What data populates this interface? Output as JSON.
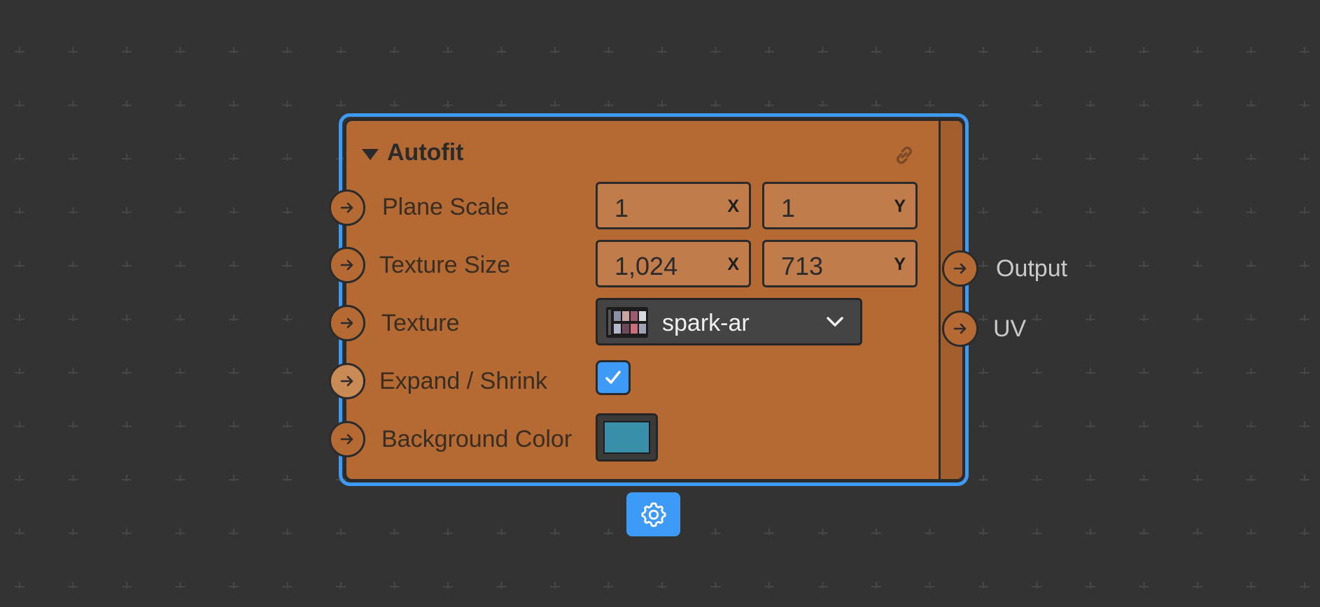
{
  "node": {
    "title": "Autofit",
    "accent_color": "#b56a33",
    "selection_color": "#3d9bf7",
    "icons": [
      "caret-down-icon",
      "link-icon",
      "settings-gear-icon",
      "arrow-right-icon",
      "checkmark-icon",
      "chevron-down-icon"
    ]
  },
  "inputs": {
    "plane_scale": {
      "label": "Plane Scale",
      "x": "1",
      "x_axis": "X",
      "y": "1",
      "y_axis": "Y"
    },
    "texture_size": {
      "label": "Texture Size",
      "x": "1,024",
      "x_axis": "X",
      "y": "713",
      "y_axis": "Y"
    },
    "texture": {
      "label": "Texture",
      "value": "spark-ar"
    },
    "expand_shrink": {
      "label": "Expand / Shrink",
      "checked": true
    },
    "background_color": {
      "label": "Background Color",
      "color": "#3a8fa8"
    }
  },
  "outputs": {
    "output": {
      "label": "Output"
    },
    "uv": {
      "label": "UV"
    }
  }
}
